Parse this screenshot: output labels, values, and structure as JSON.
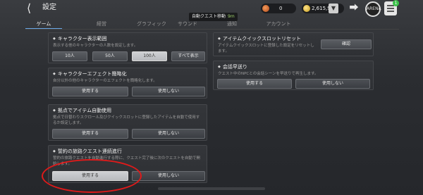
{
  "header": {
    "back_icon": "back-arrow-icon",
    "title": "設定",
    "auto_quest": {
      "label": "自動クエスト移動",
      "time": "9m"
    },
    "resource1": {
      "icon": "gem-icon",
      "value": "0"
    },
    "resource2": {
      "icon": "gold-coin-icon",
      "value": "2,615,939"
    },
    "emblem_text": "ARENA",
    "menu_badge": "1"
  },
  "tabs": [
    {
      "label": "ゲーム",
      "active": true
    },
    {
      "label": "経営",
      "active": false
    },
    {
      "label": "グラフィック",
      "active": false
    },
    {
      "label": "サウンド",
      "active": false
    },
    {
      "label": "通知",
      "active": false
    },
    {
      "label": "アカウント",
      "active": false
    }
  ],
  "panels": {
    "character_range": {
      "title": "キャラクター表示範囲",
      "desc": "表示する他のキャラクターの人数を設定します。",
      "buttons": [
        "10人",
        "50人",
        "100人",
        "すべて表示"
      ]
    },
    "effect_simplify": {
      "title": "キャラクターエフェクト簡略化",
      "desc": "自分以外の他のキャラクターのエフェクトを簡略化します。",
      "on": "使用する",
      "off": "使用しない"
    },
    "auto_item": {
      "title": "拠点でアイテム自動使用",
      "desc": "拠点で日替わりスクロール及びクイックスロットに登録したアイテムを自動で使用するか設定します。",
      "on": "使用する",
      "off": "使用しない"
    },
    "oath_quest": {
      "title": "誓約の旅路クエスト連続進行",
      "desc": "誓約の旅路クエストを自動進行する際に、クエスト完了後に次のクエストを自動で開始します。",
      "on": "使用する",
      "off": "使用しない"
    },
    "quickslot_reset": {
      "title": "アイテムクイックスロットリセット",
      "desc": "アイテムクイックスロットに登録した設定をリセットします。",
      "confirm": "確認"
    },
    "dialogue_skip": {
      "title": "会話早送り",
      "desc": "クエスト中のNPCとの会話シーンを早送りで再生します。",
      "on": "使用する",
      "off": "使用しない"
    }
  }
}
